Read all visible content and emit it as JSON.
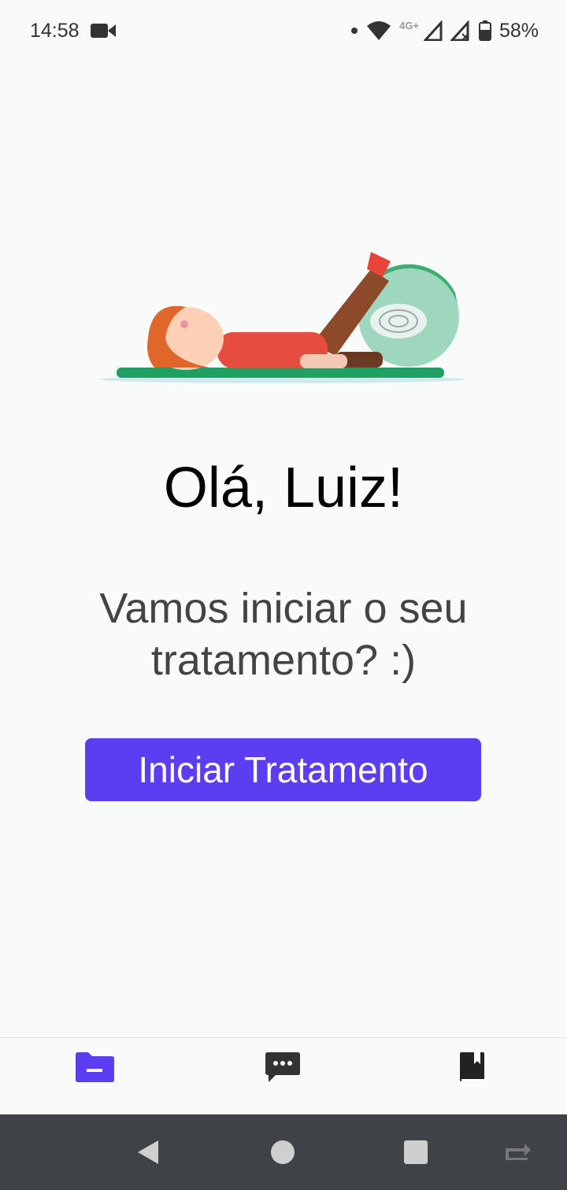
{
  "status_bar": {
    "time": "14:58",
    "network": "4G+",
    "battery": "58%",
    "icons": [
      "video-camera-icon",
      "dot-icon",
      "wifi-icon",
      "signal-icon",
      "signal-no-sim-icon",
      "battery-icon"
    ]
  },
  "main": {
    "greeting": "Olá, Luiz!",
    "subtitle": "Vamos iniciar o seu tratamento? :)",
    "cta_label": "Iniciar Tratamento"
  },
  "bottom_nav": {
    "items": [
      {
        "icon": "folder-icon",
        "active": true
      },
      {
        "icon": "chat-icon",
        "active": false
      },
      {
        "icon": "book-icon",
        "active": false
      }
    ]
  },
  "colors": {
    "accent": "#5b3ef2",
    "background": "#f8fbfa",
    "system_nav": "#3f4347"
  }
}
